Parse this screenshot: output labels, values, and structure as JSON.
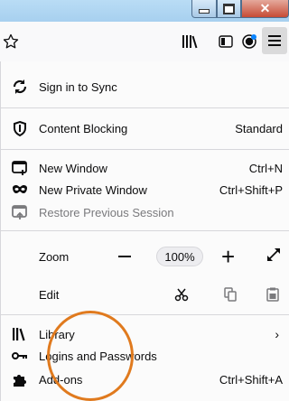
{
  "window": {
    "close_glyph": "✕"
  },
  "menu": {
    "sync": {
      "label": "Sign in to Sync"
    },
    "content_blocking": {
      "label": "Content Blocking",
      "value": "Standard"
    },
    "new_window": {
      "label": "New Window",
      "shortcut": "Ctrl+N"
    },
    "private_window": {
      "label": "New Private Window",
      "shortcut": "Ctrl+Shift+P"
    },
    "restore_session": {
      "label": "Restore Previous Session"
    },
    "zoom": {
      "label": "Zoom",
      "value": "100%",
      "plus": "+"
    },
    "edit": {
      "label": "Edit"
    },
    "library": {
      "label": "Library",
      "chevron": "›"
    },
    "logins": {
      "label": "Logins and Passwords"
    },
    "addons": {
      "label": "Add-ons",
      "shortcut": "Ctrl+Shift+A"
    }
  },
  "icons": [
    "star-icon",
    "library-icon",
    "sidebar-icon",
    "account-icon",
    "hamburger-menu-icon",
    "sync-icon",
    "shield-icon",
    "new-window-icon",
    "mask-icon",
    "restore-icon",
    "fullscreen-icon",
    "cut-icon",
    "copy-icon",
    "paste-icon",
    "library-books-icon",
    "key-icon",
    "puzzle-icon"
  ],
  "colors": {
    "annotation_circle": "#e07a1e",
    "close_button": "#c64b35",
    "separator": "#d7d7db"
  }
}
